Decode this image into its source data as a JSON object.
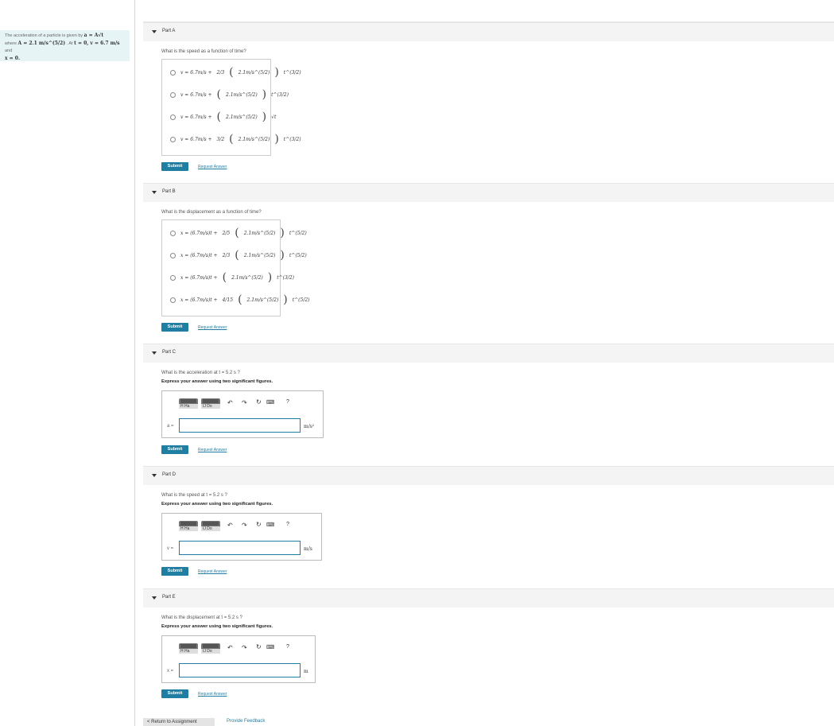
{
  "problem": {
    "line1": "The acceleration of a particle is given by",
    "formula1": "a = A√t",
    "line2a": "where",
    "A_value": "A = 2.1 m/s^(5/2)",
    "line2b": ". At",
    "init": "t = 0, v = 6.7 m/s",
    "line2c": "and",
    "x0": "x = 0."
  },
  "parts": [
    {
      "label": "Part A",
      "question": "What is the speed as a function of time?",
      "choices": [
        {
          "lead": "v = 6.7m/s + ",
          "coef": "2/3",
          "inner": "2.1m/s^(5/2)",
          "pow": "t^(3/2)"
        },
        {
          "lead": "v = 6.7m/s + ",
          "coef": "",
          "inner": "2.1m/s^(5/2)",
          "pow": "t^(3/2)"
        },
        {
          "lead": "v = 6.7m/s + ",
          "coef": "",
          "inner": "2.1m/s^(5/2)",
          "pow": "√t"
        },
        {
          "lead": "v = 6.7m/s + ",
          "coef": "3/2",
          "inner": "2.1m/s^(5/2)",
          "pow": "t^(3/2)"
        }
      ]
    },
    {
      "label": "Part B",
      "question": "What is the displacement as a function of time?",
      "choices": [
        {
          "lead": "x = (6.7m/s)t + ",
          "coef": "2/5",
          "inner": "2.1m/s^(5/2)",
          "pow": "t^(5/2)"
        },
        {
          "lead": "x = (6.7m/s)t + ",
          "coef": "2/3",
          "inner": "2.1m/s^(5/2)",
          "pow": "t^(5/2)"
        },
        {
          "lead": "x = (6.7m/s)t + ",
          "coef": "",
          "inner": "2.1m/s^(5/2)",
          "pow": "t^(3/2)"
        },
        {
          "lead": "x = (6.7m/s)t + ",
          "coef": "4/15",
          "inner": "2.1m/s^(5/2)",
          "pow": "t^(5/2)"
        }
      ]
    },
    {
      "label": "Part C",
      "question": "What is the acceleration at t = 5.2 s ?",
      "instruction": "Express your answer using two significant figures.",
      "var": "a =",
      "unit": "m/s²"
    },
    {
      "label": "Part D",
      "question": "What is the speed at t = 5.2 s ?",
      "instruction": "Express your answer using two significant figures.",
      "var": "v =",
      "unit": "m/s"
    },
    {
      "label": "Part E",
      "question": "What is the displacement at t = 5.2 s ?",
      "instruction": "Express your answer using two significant figures.",
      "var": "x =",
      "unit": "m"
    }
  ],
  "buttons": {
    "submit": "Submit",
    "request": "Request Answer"
  },
  "toolbar": {
    "btn1": "H",
    "btn2": "Ha",
    "btn3": "IJ",
    "btn4": "Do",
    "undo": "↶",
    "redo": "↷",
    "reset": "↻",
    "keyboard": "⌨",
    "help": "?"
  },
  "footer": {
    "back": "< Return to Assignment",
    "feedback": "Provide Feedback"
  },
  "colors": {
    "accent": "#1f7ea1",
    "problem_bg": "#e6f4f6"
  }
}
